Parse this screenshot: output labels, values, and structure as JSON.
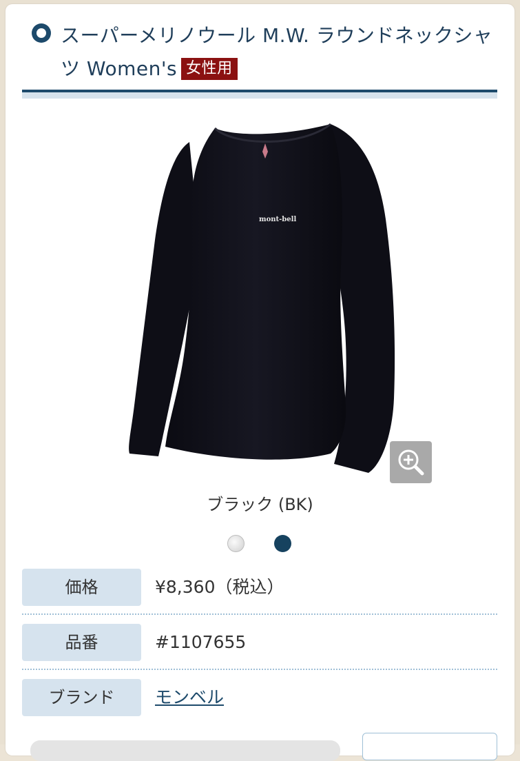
{
  "header": {
    "title": "スーパーメリノウール M.W. ラウンドネックシャツ Women's",
    "gender_badge": "女性用"
  },
  "product": {
    "image_alt": "Black long-sleeve round neck shirt",
    "logo_text": "mont-bell",
    "selected_color": "ブラック (BK)",
    "colors": [
      {
        "name": "light-gray",
        "hex": "#d9d9d9"
      },
      {
        "name": "navy",
        "hex": "#16425f"
      }
    ]
  },
  "specs": [
    {
      "label": "価格",
      "value": "¥8,360（税込）"
    },
    {
      "label": "品番",
      "value": "#1107655"
    },
    {
      "label": "ブランド",
      "value": "モンベル"
    }
  ],
  "theme": {
    "accent": "#1d4a6b",
    "badge": "#8b1111",
    "label_bg": "#d6e3ee"
  }
}
